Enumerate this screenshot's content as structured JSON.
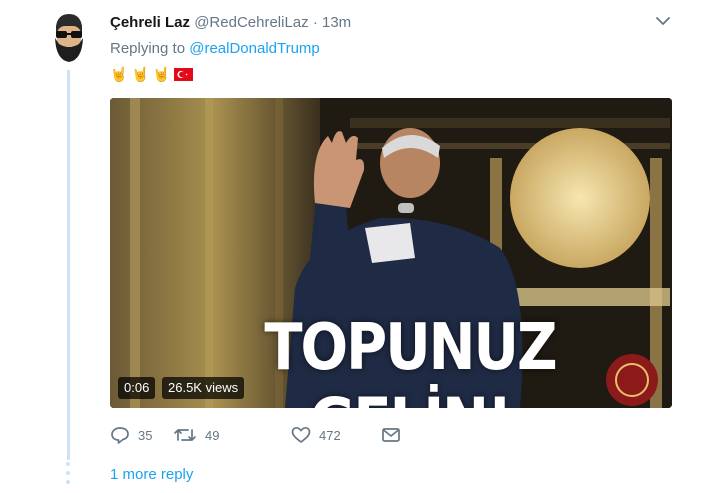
{
  "tweet": {
    "display_name": "Çehreli Laz",
    "handle": "@RedCehreliLaz",
    "separator": "·",
    "time": "13m",
    "replying_label": "Replying to",
    "replying_to": "@realDonaldTrump",
    "emojis": [
      "horns-emoji",
      "horns-emoji",
      "horns-emoji",
      "turkey-flag-emoji"
    ]
  },
  "media": {
    "caption": "TOPUNUZ GELİN!",
    "duration": "0:06",
    "views": "26.5K views"
  },
  "actions": {
    "reply_count": "35",
    "retweet_count": "49",
    "like_count": "472"
  },
  "thread": {
    "more_replies": "1 more reply"
  },
  "colors": {
    "link": "#1da1f2",
    "secondary_text": "#657786",
    "thread_line": "#cfe2f3"
  }
}
